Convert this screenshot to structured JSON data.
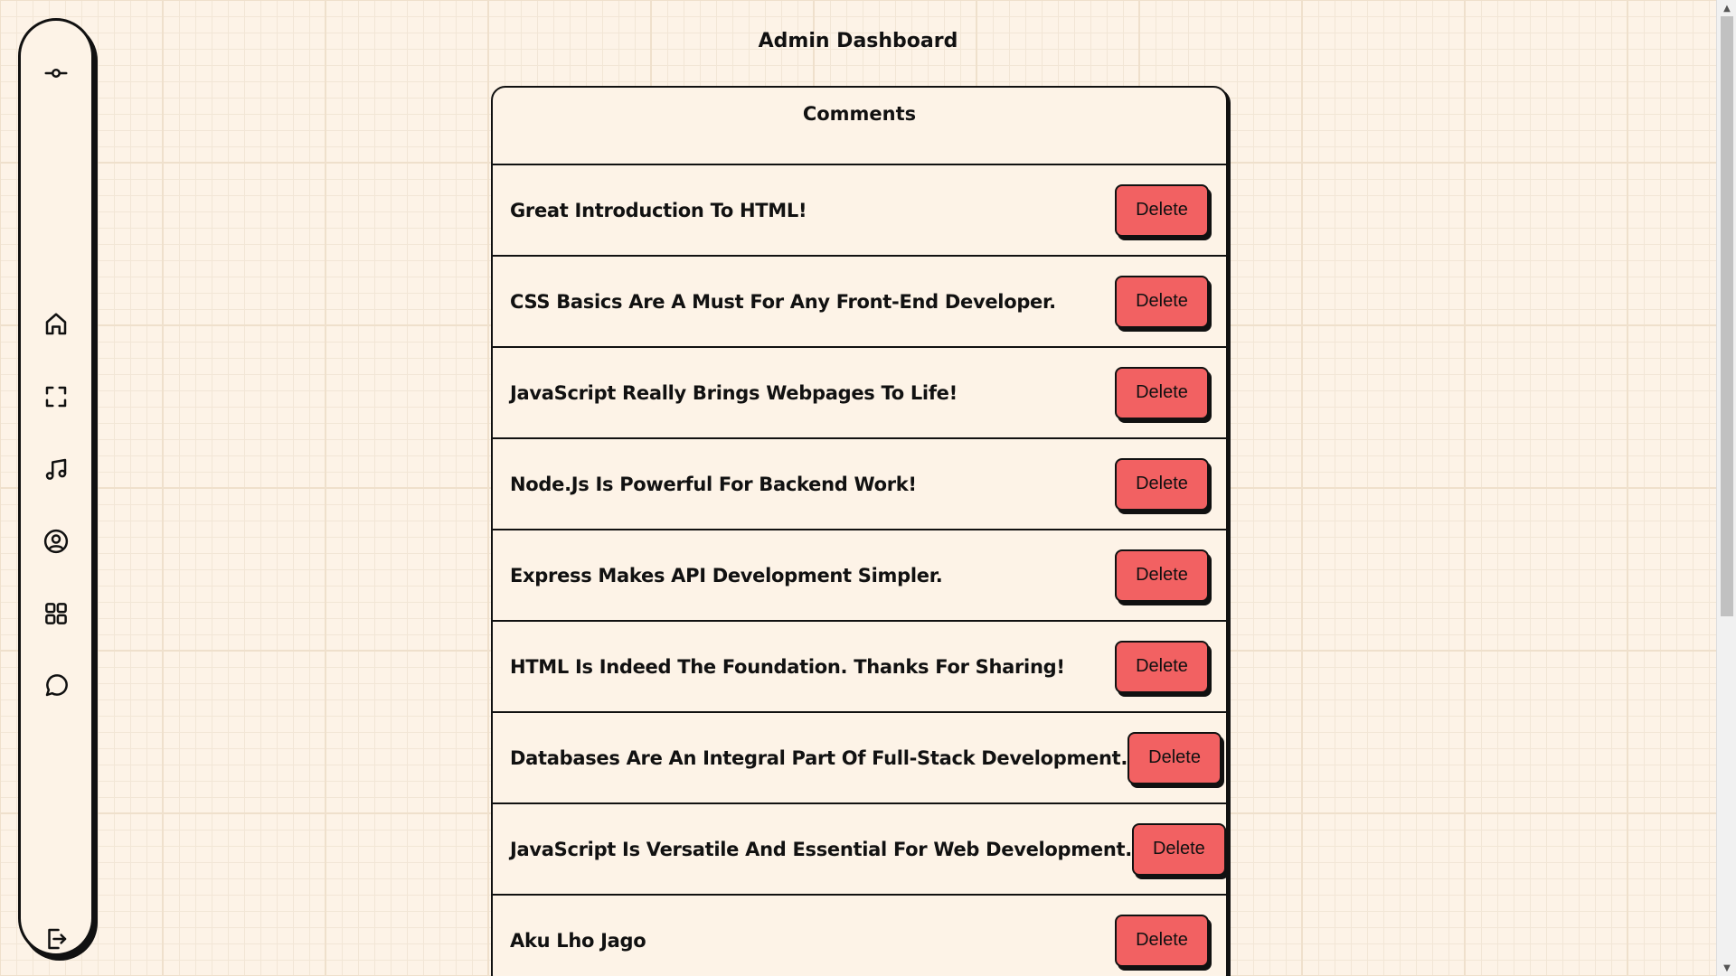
{
  "header": {
    "title": "Admin Dashboard"
  },
  "sidebar": {
    "items": [
      {
        "name": "commit-icon"
      },
      {
        "name": "home-icon"
      },
      {
        "name": "fullscreen-icon"
      },
      {
        "name": "music-icon"
      },
      {
        "name": "user-circle-icon"
      },
      {
        "name": "grid-icon"
      },
      {
        "name": "chat-icon"
      },
      {
        "name": "logout-icon"
      }
    ]
  },
  "comments": {
    "title": "Comments",
    "delete_label": "Delete",
    "items": [
      {
        "text": "Great Introduction To HTML!"
      },
      {
        "text": "CSS Basics Are A Must For Any Front-End Developer."
      },
      {
        "text": "JavaScript Really Brings Webpages To Life!"
      },
      {
        "text": "Node.Js Is Powerful For Backend Work!"
      },
      {
        "text": "Express Makes API Development Simpler."
      },
      {
        "text": "HTML Is Indeed The Foundation. Thanks For Sharing!"
      },
      {
        "text": "Databases Are An Integral Part Of Full-Stack Development."
      },
      {
        "text": "JavaScript Is Versatile And Essential For Web Development."
      },
      {
        "text": "Aku Lho Jago"
      }
    ]
  },
  "colors": {
    "background": "#fdf3e7",
    "delete_button": "#f26162",
    "border": "#111111"
  }
}
